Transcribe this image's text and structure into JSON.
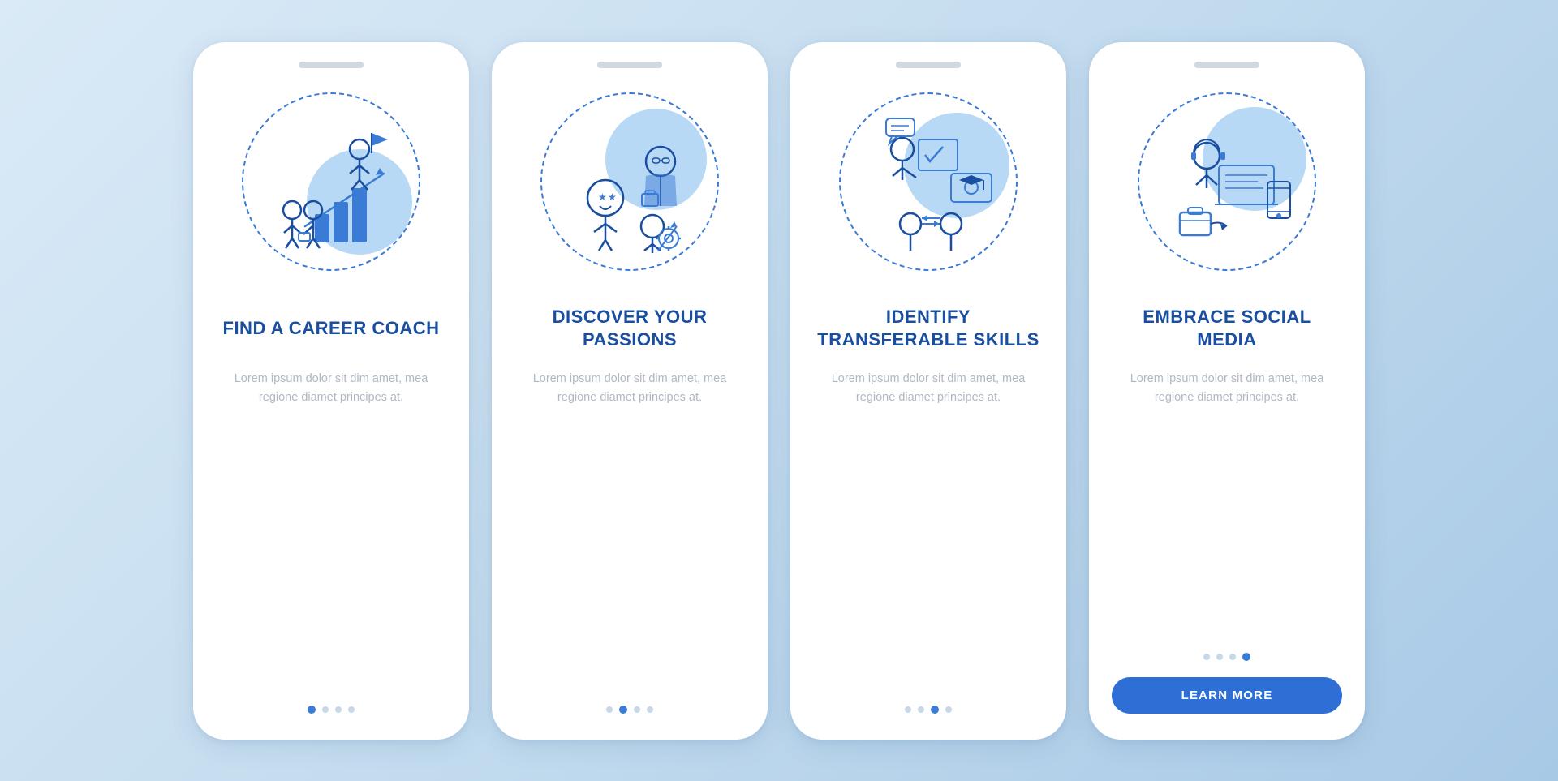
{
  "background": {
    "color": "#c8dff0"
  },
  "cards": [
    {
      "id": "career-coach",
      "title": "FIND A CAREER COACH",
      "description": "Lorem ipsum dolor sit dim amet, mea regione diamet principes at.",
      "dots": [
        true,
        false,
        false,
        false
      ],
      "active_dot": 0,
      "has_button": false,
      "icon": "career-coach-icon"
    },
    {
      "id": "discover-passions",
      "title": "DISCOVER YOUR PASSIONS",
      "description": "Lorem ipsum dolor sit dim amet, mea regione diamet principes at.",
      "dots": [
        false,
        true,
        false,
        false
      ],
      "active_dot": 1,
      "has_button": false,
      "icon": "passions-icon"
    },
    {
      "id": "transferable-skills",
      "title": "IDENTIFY TRANSFERABLE SKILLS",
      "description": "Lorem ipsum dolor sit dim amet, mea regione diamet principes at.",
      "dots": [
        false,
        false,
        true,
        false
      ],
      "active_dot": 2,
      "has_button": false,
      "icon": "skills-icon"
    },
    {
      "id": "social-media",
      "title": "EMBRACE SOCIAL MEDIA",
      "description": "Lorem ipsum dolor sit dim amet, mea regione diamet principes at.",
      "dots": [
        false,
        false,
        false,
        true
      ],
      "active_dot": 3,
      "has_button": true,
      "button_label": "LEARN MORE",
      "icon": "social-media-icon"
    }
  ]
}
